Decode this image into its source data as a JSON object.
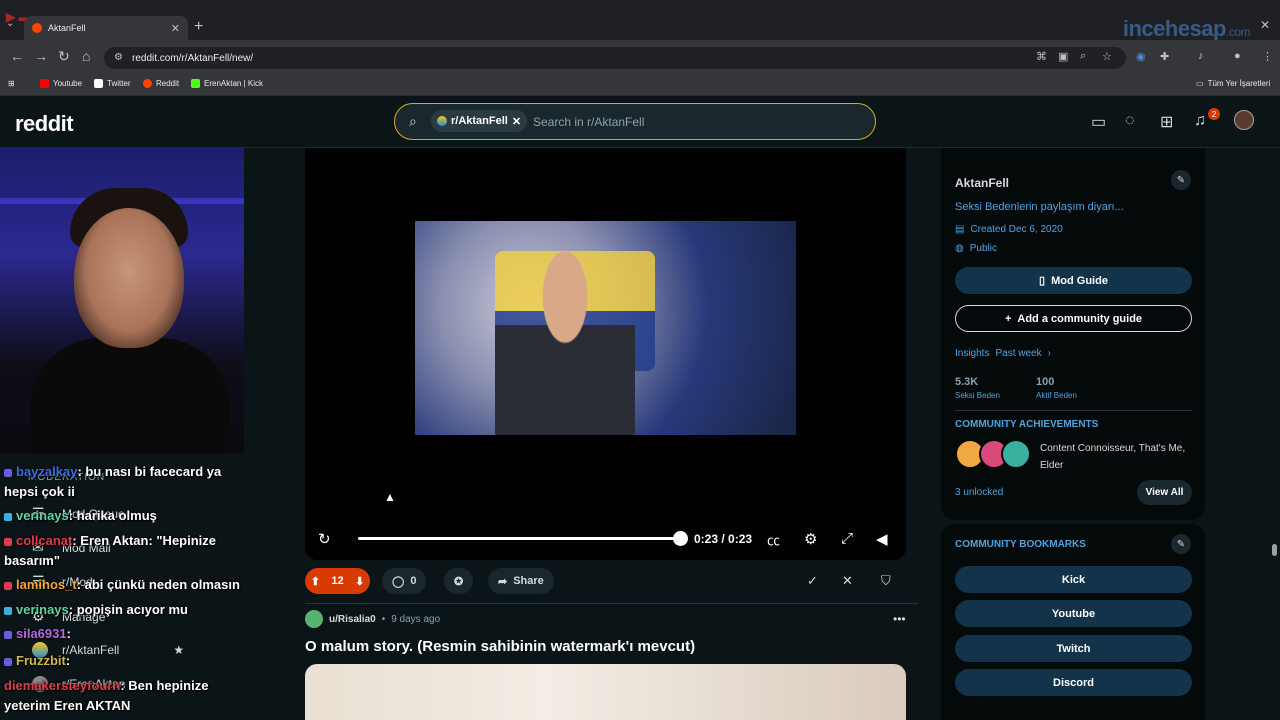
{
  "browser": {
    "tab_title": "AktanFell",
    "url": "reddit.com/r/AktanFell/new/",
    "watermark_brand": "incehesap",
    "watermark_brand_suffix": ".com",
    "bookmarks": [
      {
        "label": "Youtube",
        "color": "#ff0000"
      },
      {
        "label": "Twitter",
        "color": "#ffffff"
      },
      {
        "label": "Reddit",
        "color": "#ff4500"
      },
      {
        "label": "ErenAktan | Kick",
        "color": "#53fc18"
      }
    ],
    "all_bookmarks": "Tüm Yer İşaretleri"
  },
  "reddit": {
    "logo": "reddit",
    "search_chip": "r/AktanFell",
    "search_placeholder": "Search in r/AktanFell",
    "notification_count": "2"
  },
  "mod_sidebar": {
    "title": "MODERATION",
    "items": [
      {
        "label": "Mod Queue",
        "icon": "queue-icon"
      },
      {
        "label": "Mod Mail",
        "icon": "mail-icon"
      },
      {
        "label": "r/Mod",
        "icon": "list-icon"
      },
      {
        "label": "Manage",
        "icon": "gear-icon"
      },
      {
        "label": "r/AktanFell",
        "icon": "community-icon"
      },
      {
        "label": "r/ErenAktan",
        "icon": "community-icon"
      }
    ]
  },
  "chat": [
    {
      "user": "bayzalkay",
      "msg": ": bu nası bi facecard ya hepsi çok ii"
    },
    {
      "user": "verinays",
      "msg": ": harika olmuş"
    },
    {
      "user": "collcanat",
      "msg": ": Eren Aktan: \"Hepinize basarım\""
    },
    {
      "user": "lamihos_t",
      "msg": ": abi çünkü neden olmasın"
    },
    {
      "user": "verinays",
      "msg": ": popişin acıyor mu"
    },
    {
      "user": "sila6931",
      "msg": ":"
    },
    {
      "user": "Fruzzbit",
      "msg": ":"
    },
    {
      "user": "diemakersteyfourn",
      "msg": ": Ben hepinize yeterim Eren AKTAN"
    }
  ],
  "video": {
    "time": "0:23 / 0:23",
    "progress": 1.0
  },
  "post_actions": {
    "votes": "12",
    "comments": "0",
    "share": "Share"
  },
  "next_post": {
    "user": "u/Risalia0",
    "time": "9 days ago",
    "title": "O malum story. (Resmin sahibinin watermark'ı mevcut)"
  },
  "community": {
    "name": "AktanFell",
    "description": "Seksi Bedenlerin paylaşım diyarı...",
    "created": "Created Dec 6, 2020",
    "visibility": "Public",
    "mod_guide": "Mod Guide",
    "add_guide": "Add a community guide",
    "insights": "Insights",
    "insights_range": "Past week",
    "members": "5.3K",
    "members_label": "Seksi Beden",
    "online": "100",
    "online_label": "Aktif Beden",
    "achievements_title": "COMMUNITY ACHIEVEMENTS",
    "achievements_text": "Content Connoisseur, That's Me, Elder",
    "unlocked": "3 unlocked",
    "view_all": "View All",
    "bookmarks_title": "COMMUNITY BOOKMARKS",
    "bookmarks": [
      "Kick",
      "Youtube",
      "Twitch",
      "Discord"
    ]
  }
}
